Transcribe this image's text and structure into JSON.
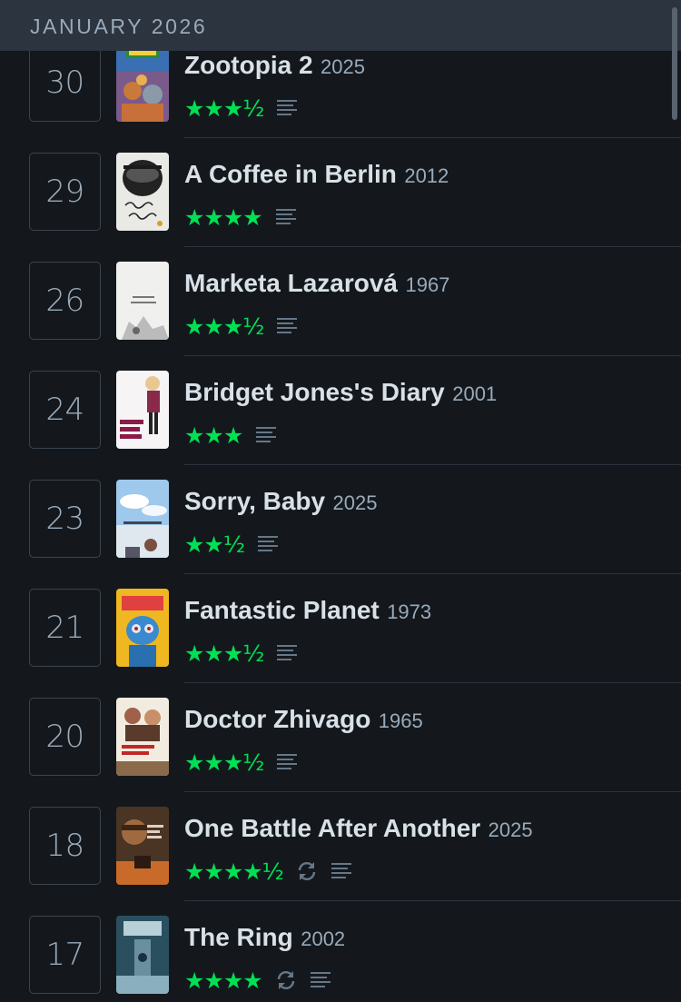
{
  "header": {
    "month": "JANUARY 2026"
  },
  "colors": {
    "background": "#14181c",
    "header": "#2c3440",
    "star": "#00e054",
    "text": "#d8e0e8",
    "muted": "#99aabb"
  },
  "entries": [
    {
      "day": "30",
      "title": "Zootopia 2",
      "year": "2025",
      "rating": "★★★½",
      "rewatch": false,
      "review": true,
      "poster": "zootopia"
    },
    {
      "day": "29",
      "title": "A Coffee in Berlin",
      "year": "2012",
      "rating": "★★★★",
      "rewatch": false,
      "review": true,
      "poster": "coffee"
    },
    {
      "day": "26",
      "title": "Marketa Lazarová",
      "year": "1967",
      "rating": "★★★½",
      "rewatch": false,
      "review": true,
      "poster": "marketa"
    },
    {
      "day": "24",
      "title": "Bridget Jones's Diary",
      "year": "2001",
      "rating": "★★★",
      "rewatch": false,
      "review": true,
      "poster": "bridget"
    },
    {
      "day": "23",
      "title": "Sorry, Baby",
      "year": "2025",
      "rating": "★★½",
      "rewatch": false,
      "review": true,
      "poster": "sorry"
    },
    {
      "day": "21",
      "title": "Fantastic Planet",
      "year": "1973",
      "rating": "★★★½",
      "rewatch": false,
      "review": true,
      "poster": "planet"
    },
    {
      "day": "20",
      "title": "Doctor Zhivago",
      "year": "1965",
      "rating": "★★★½",
      "rewatch": false,
      "review": true,
      "poster": "zhivago"
    },
    {
      "day": "18",
      "title": "One Battle After Another",
      "year": "2025",
      "rating": "★★★★½",
      "rewatch": true,
      "review": true,
      "poster": "battle"
    },
    {
      "day": "17",
      "title": "The Ring",
      "year": "2002",
      "rating": "★★★★",
      "rewatch": true,
      "review": true,
      "poster": "ring"
    }
  ]
}
